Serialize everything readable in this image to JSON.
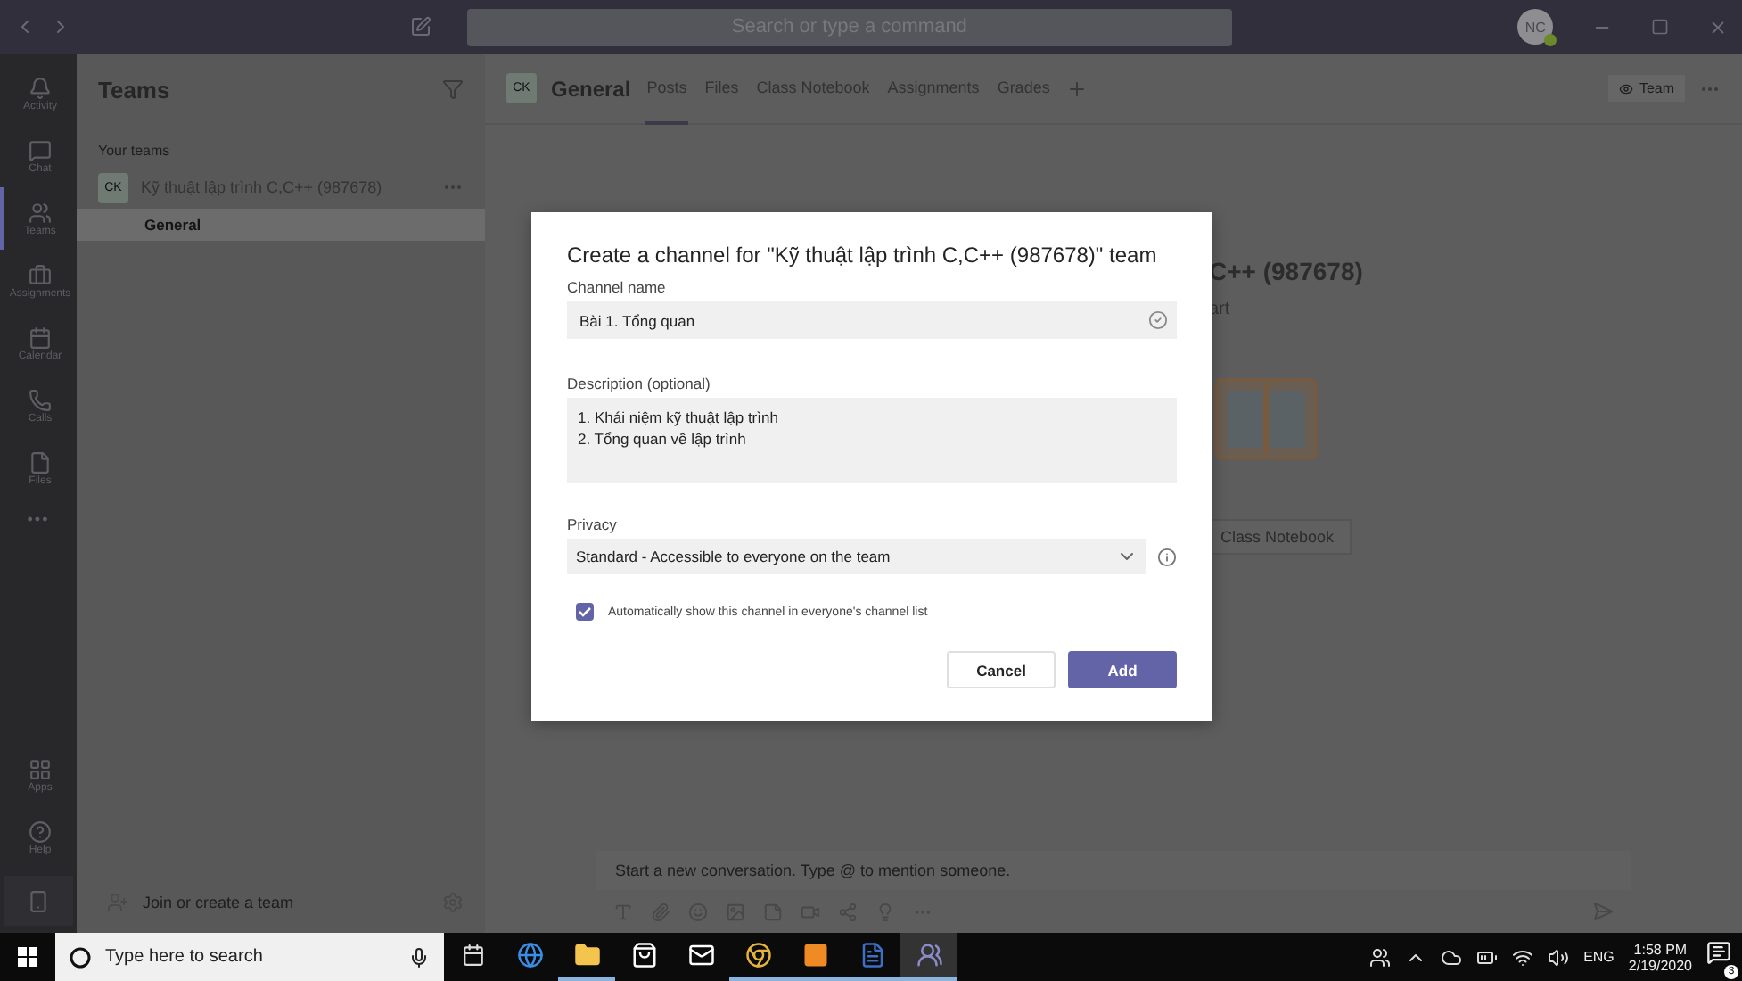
{
  "title_bar": {
    "search": {
      "placeholder": "Search or type a command"
    },
    "avatar": {
      "initials": "NC",
      "online": true
    }
  },
  "rail": {
    "items": [
      {
        "kind": "activity",
        "label": "Activity",
        "selected": false
      },
      {
        "kind": "chat",
        "label": "Chat",
        "selected": false
      },
      {
        "kind": "teams",
        "label": "Teams",
        "selected": true
      },
      {
        "kind": "assignments",
        "label": "Assignments",
        "selected": false
      },
      {
        "kind": "calendar",
        "label": "Calendar",
        "selected": false
      },
      {
        "kind": "calls",
        "label": "Calls",
        "selected": false
      },
      {
        "kind": "files",
        "label": "Files",
        "selected": false
      }
    ],
    "more": "•••",
    "bottom_items": [
      {
        "kind": "apps",
        "label": "Apps"
      },
      {
        "kind": "help",
        "label": "Help"
      }
    ]
  },
  "teams_panel": {
    "title": "Teams",
    "section": "Your teams",
    "teams": [
      {
        "initials": "CK",
        "name": "Kỹ thuật lập trình C,C++ (987678)",
        "channels": [
          {
            "name": "General",
            "selected": true
          }
        ]
      }
    ],
    "join": "Join or create a team"
  },
  "channel_header": {
    "initials": "CK",
    "name": "General",
    "tabs": [
      {
        "label": "Posts",
        "selected": true
      },
      {
        "label": "Files",
        "selected": false
      },
      {
        "label": "Class Notebook",
        "selected": false
      },
      {
        "label": "Assignments",
        "selected": false
      },
      {
        "label": "Grades",
        "selected": false
      }
    ],
    "team_button": "Team"
  },
  "welcome": {
    "title": "C++ (987678)",
    "subtitle": "art",
    "button": "Class Notebook"
  },
  "compose": {
    "placeholder": "Start a new conversation. Type @ to mention someone."
  },
  "dialog": {
    "title": "Create a channel for \"Kỹ thuật lập trình C,C++ (987678)\" team",
    "name_label": "Channel name",
    "name_value": "Bài 1. Tổng quan",
    "description_label": "Description (optional)",
    "description_lines": [
      "1. Khái niệm kỹ thuật lập trình",
      "2. Tổng quan về lập trình"
    ],
    "privacy_label": "Privacy",
    "privacy_value": "Standard - Accessible to everyone on the team",
    "auto_show": {
      "label": "Automatically show this channel in everyone's channel list",
      "checked": true
    },
    "buttons": [
      {
        "kind": "secondary",
        "label": "Cancel"
      },
      {
        "kind": "primary",
        "label": "Add"
      }
    ]
  },
  "taskbar": {
    "search": {
      "placeholder": "Type here to search"
    },
    "apps": [
      {
        "kind": "edge",
        "running": false,
        "selected": false
      },
      {
        "kind": "explorer",
        "running": true,
        "selected": false
      },
      {
        "kind": "store",
        "running": false,
        "selected": false
      },
      {
        "kind": "mail",
        "running": false,
        "selected": false
      },
      {
        "kind": "chrome",
        "running": true,
        "selected": false
      },
      {
        "kind": "orange",
        "running": true,
        "selected": false
      },
      {
        "kind": "word",
        "running": true,
        "selected": false
      },
      {
        "kind": "teams",
        "running": true,
        "selected": true
      }
    ],
    "language": "ENG",
    "time": "1:58 PM",
    "date": "2/19/2020",
    "notifications": "3"
  }
}
